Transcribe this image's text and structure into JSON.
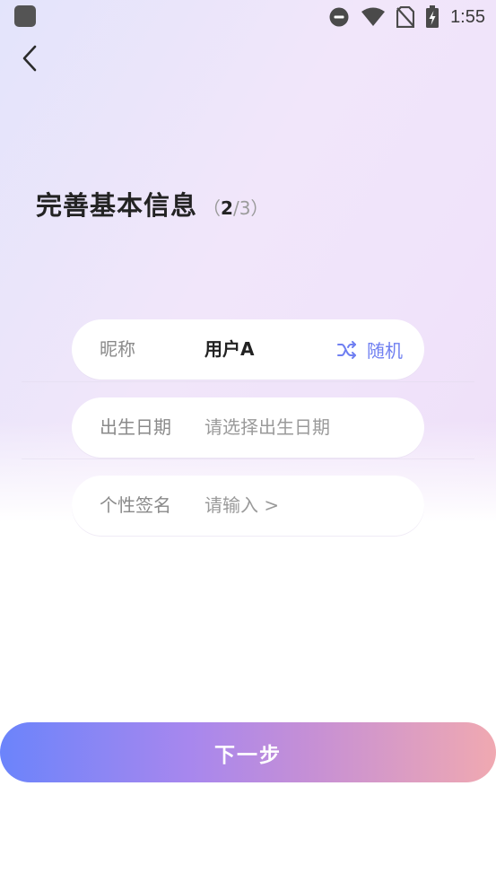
{
  "status_bar": {
    "time": "1:55",
    "icons": [
      "app-icon",
      "do-not-disturb-icon",
      "wifi-icon",
      "no-sim-icon",
      "battery-charging-icon"
    ]
  },
  "nav": {
    "back_icon": "chevron-left-icon"
  },
  "header": {
    "title": "完善基本信息",
    "step_open": "（",
    "step_current": "2",
    "step_separator": "/",
    "step_total": "3",
    "step_close": "）"
  },
  "form": {
    "nickname": {
      "label": "昵称",
      "value": "用户A",
      "random_label": "随机",
      "random_icon": "shuffle-icon"
    },
    "birthday": {
      "label": "出生日期",
      "placeholder": "请选择出生日期"
    },
    "signature": {
      "label": "个性签名",
      "placeholder": "请输入 >"
    }
  },
  "footer": {
    "next_label": "下一步"
  },
  "colors": {
    "accent_blue": "#6f7ff1",
    "button_gradient_start": "#6b84fb",
    "button_gradient_end": "#f0a9b1"
  }
}
